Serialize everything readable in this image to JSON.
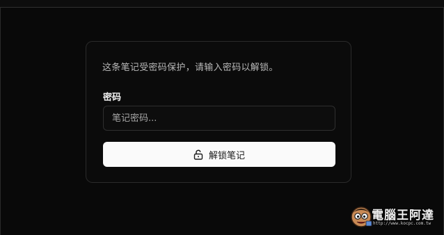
{
  "unlock_form": {
    "description": "这条笔记受密码保护，请输入密码以解锁。",
    "password_label": "密码",
    "password_placeholder": "笔记密码...",
    "password_value": "",
    "unlock_button_label": "解锁笔记",
    "unlock_icon": "unlock-icon"
  },
  "watermark": {
    "title": "電腦王阿達",
    "url": "http://www.kocpc.com.tw"
  },
  "colors": {
    "background": "#090909",
    "card_border": "#2b2b2b",
    "button_bg": "#fafafa",
    "button_text": "#1a1a1a",
    "muted_text": "#b8b8b8"
  }
}
